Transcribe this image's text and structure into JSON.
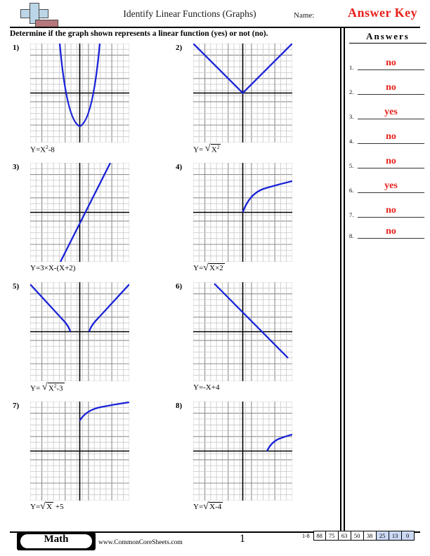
{
  "header": {
    "title": "Identify Linear Functions (Graphs)",
    "name_label": "Name:",
    "answer_key": "Answer Key",
    "logo_icon": "plus-book-logo"
  },
  "instructions": "Determine if the graph shown represents a linear function (yes) or not (no).",
  "answers_panel": {
    "heading": "Answers",
    "rows": [
      {
        "num": "1.",
        "value": "no"
      },
      {
        "num": "2.",
        "value": "no"
      },
      {
        "num": "3.",
        "value": "yes"
      },
      {
        "num": "4.",
        "value": "no"
      },
      {
        "num": "5.",
        "value": "no"
      },
      {
        "num": "6.",
        "value": "yes"
      },
      {
        "num": "7.",
        "value": "no"
      },
      {
        "num": "8.",
        "value": "no"
      }
    ],
    "answer_color": "#e8201a"
  },
  "problems": [
    {
      "num": "1)",
      "eq_prefix": "Y=X",
      "eq_sup": "2",
      "eq_suffix": "-8",
      "radical": false,
      "curve": "parabola",
      "answer": "no"
    },
    {
      "num": "2)",
      "eq_prefix": "Y= ",
      "eq_radicand": "X",
      "eq_sup": "2",
      "eq_suffix": "",
      "radical": true,
      "curve": "absolute-value",
      "answer": "no"
    },
    {
      "num": "3)",
      "eq_prefix": "Y=3×X-(X+2)",
      "eq_sup": "",
      "eq_suffix": "",
      "radical": false,
      "curve": "line-up",
      "answer": "yes"
    },
    {
      "num": "4)",
      "eq_prefix": "Y=",
      "eq_radicand": "X×2",
      "eq_sup": "",
      "eq_suffix": "",
      "radical": true,
      "curve": "sqrt",
      "answer": "no"
    },
    {
      "num": "5)",
      "eq_prefix": "Y= ",
      "eq_radicand": "X",
      "eq_sup": "2",
      "eq_suffix": "-3",
      "radical": true,
      "curve": "sqrt-x2-minus3",
      "answer": "no"
    },
    {
      "num": "6)",
      "eq_prefix": "Y=-X+4",
      "eq_sup": "",
      "eq_suffix": "",
      "radical": false,
      "curve": "line-down",
      "answer": "yes"
    },
    {
      "num": "7)",
      "eq_prefix": "Y=",
      "eq_radicand": "X",
      "eq_sup": "",
      "eq_suffix": " +5",
      "radical": true,
      "curve": "sqrt-plus5",
      "answer": "no"
    },
    {
      "num": "8)",
      "eq_prefix": "Y=",
      "eq_radicand": "X-4",
      "eq_sup": "",
      "eq_suffix": "",
      "radical": true,
      "curve": "sqrt-x-minus4",
      "answer": "no"
    }
  ],
  "chart_data": [
    {
      "type": "line",
      "title": "Y=X²-8",
      "xlim": [
        -8.5,
        8.5
      ],
      "ylim": [
        -8.5,
        8.5
      ],
      "grid": true,
      "function": "y = x^2 - 8",
      "linear": false,
      "color": "#1a23d8"
    },
    {
      "type": "line",
      "title": "Y=√(X²)",
      "xlim": [
        -8.5,
        8.5
      ],
      "ylim": [
        -8.5,
        8.5
      ],
      "grid": true,
      "function": "y = |x|",
      "linear": false,
      "color": "#1a23d8"
    },
    {
      "type": "line",
      "title": "Y=3×X-(X+2)",
      "xlim": [
        -8.5,
        8.5
      ],
      "ylim": [
        -8.5,
        8.5
      ],
      "grid": true,
      "function": "y = 2x - 2",
      "linear": true,
      "color": "#1a23d8"
    },
    {
      "type": "line",
      "title": "Y=√(X×2)",
      "xlim": [
        -8.5,
        8.5
      ],
      "ylim": [
        -8.5,
        8.5
      ],
      "grid": true,
      "function": "y = sqrt(2x)",
      "linear": false,
      "color": "#1a23d8"
    },
    {
      "type": "line",
      "title": "Y=√(X²-3)",
      "xlim": [
        -8.5,
        8.5
      ],
      "ylim": [
        -8.5,
        8.5
      ],
      "grid": true,
      "function": "y = sqrt(x^2 - 3)",
      "linear": false,
      "color": "#1a23d8"
    },
    {
      "type": "line",
      "title": "Y=-X+4",
      "xlim": [
        -8.5,
        8.5
      ],
      "ylim": [
        -8.5,
        8.5
      ],
      "grid": true,
      "function": "y = -x + 4",
      "linear": true,
      "color": "#1a23d8"
    },
    {
      "type": "line",
      "title": "Y=√X +5",
      "xlim": [
        -8.5,
        8.5
      ],
      "ylim": [
        -8.5,
        8.5
      ],
      "grid": true,
      "function": "y = sqrt(x) + 5",
      "linear": false,
      "color": "#1a23d8"
    },
    {
      "type": "line",
      "title": "Y=√(X-4)",
      "xlim": [
        -8.5,
        8.5
      ],
      "ylim": [
        -8.5,
        8.5
      ],
      "grid": true,
      "function": "y = sqrt(x - 4)",
      "linear": false,
      "color": "#1a23d8"
    }
  ],
  "footer": {
    "badge": "Math",
    "site": "www.CommonCoreSheets.com",
    "page": "1",
    "score_label": "1-8",
    "scores": [
      "88",
      "75",
      "63",
      "50",
      "38",
      "25",
      "13",
      "0"
    ],
    "highlight_from": 5,
    "highlight_color": "#ccd9f5"
  }
}
